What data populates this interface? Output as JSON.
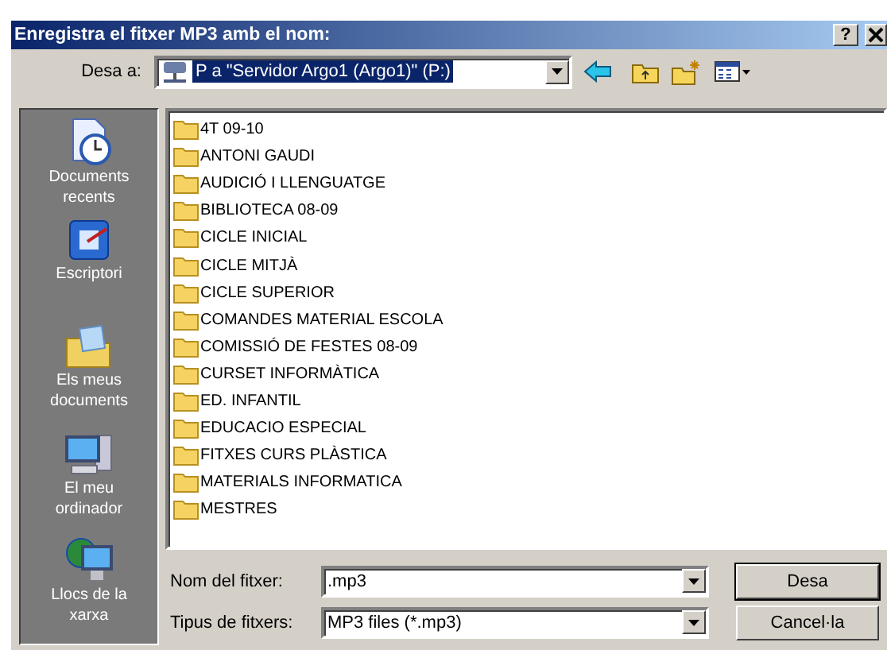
{
  "window": {
    "title": "Enregistra el fitxer MP3 amb el nom:",
    "help": "?"
  },
  "toolbar": {
    "label": "Desa a:",
    "location": "P a \"Servidor Argo1 (Argo1)\" (P:)"
  },
  "places": [
    {
      "label": "Documents recents",
      "kind": "recent"
    },
    {
      "label": "Escriptori",
      "kind": "desktop"
    },
    {
      "label": "Els meus documents",
      "kind": "documents"
    },
    {
      "label": "El meu ordinador",
      "kind": "computer"
    },
    {
      "label": "Llocs de la xarxa",
      "kind": "network"
    }
  ],
  "folders": [
    "4T 09-10",
    "ANTONI GAUDI",
    "AUDICIÓ I LLENGUATGE",
    "BIBLIOTECA 08-09",
    "CICLE INICIAL",
    "CICLE MITJÀ",
    "CICLE SUPERIOR",
    "COMANDES MATERIAL ESCOLA",
    "COMISSIÓ DE FESTES 08-09",
    "CURSET INFORMÀTICA",
    "ED. INFANTIL",
    "EDUCACIO ESPECIAL",
    "FITXES CURS PLÀSTICA",
    "MATERIALS INFORMATICA",
    "MESTRES"
  ],
  "file_name": {
    "label": "Nom del fitxer:",
    "value": ".mp3"
  },
  "file_type": {
    "label": "Tipus de fitxers:",
    "value": "MP3 files (*.mp3)"
  },
  "buttons": [
    "Desa",
    "Cancel·la"
  ]
}
